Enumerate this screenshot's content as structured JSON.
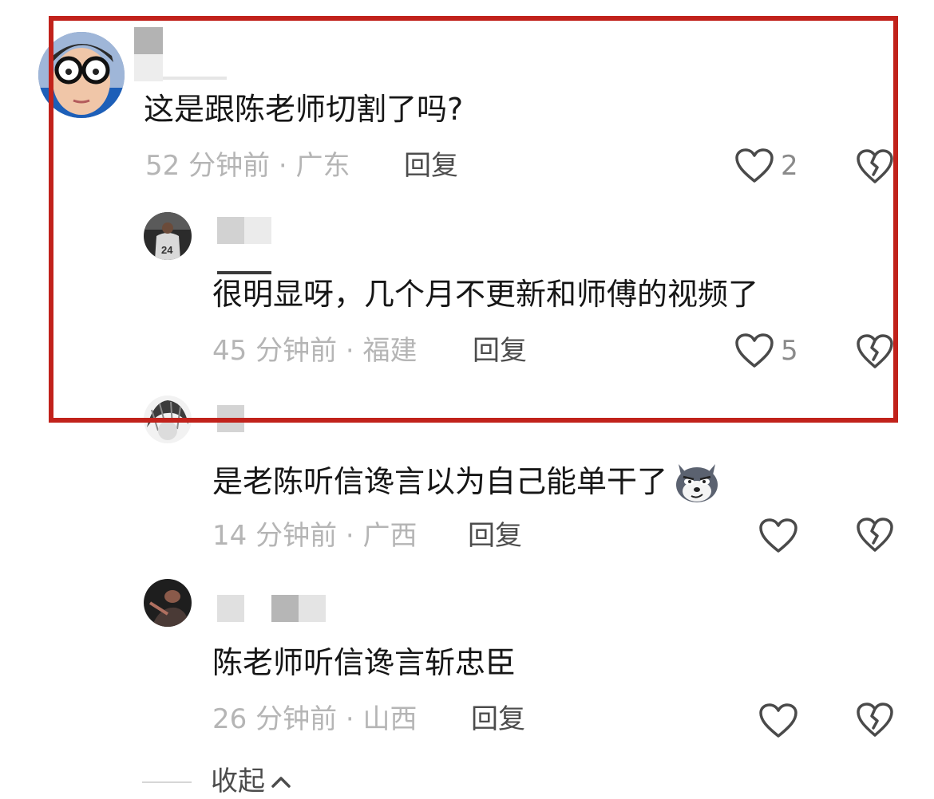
{
  "comments": [
    {
      "text": "这是跟陈老师切割了吗?",
      "meta": "52 分钟前 · 广东",
      "reply_label": "回复",
      "like_count": "2"
    }
  ],
  "replies": [
    {
      "text": "很明显呀，几个月不更新和师傅的视频了",
      "meta": "45 分钟前 · 福建",
      "reply_label": "回复",
      "like_count": "5"
    },
    {
      "text": "是老陈听信谗言以为自己能单干了",
      "meta": "14 分钟前 · 广西",
      "reply_label": "回复",
      "like_count": ""
    },
    {
      "text": "陈老师听信谗言斩忠臣",
      "meta": "26 分钟前 · 山西",
      "reply_label": "回复",
      "like_count": ""
    }
  ],
  "collapse_label": "收起",
  "icons": {
    "like": "heart-outline-icon",
    "dislike": "broken-heart-icon",
    "emoji": "husky-dog-emoji-icon",
    "collapse": "chevron-up-icon"
  },
  "colors": {
    "highlight_border": "#c1221b",
    "meta_text": "#b5b5b5",
    "body_text": "#161616"
  }
}
